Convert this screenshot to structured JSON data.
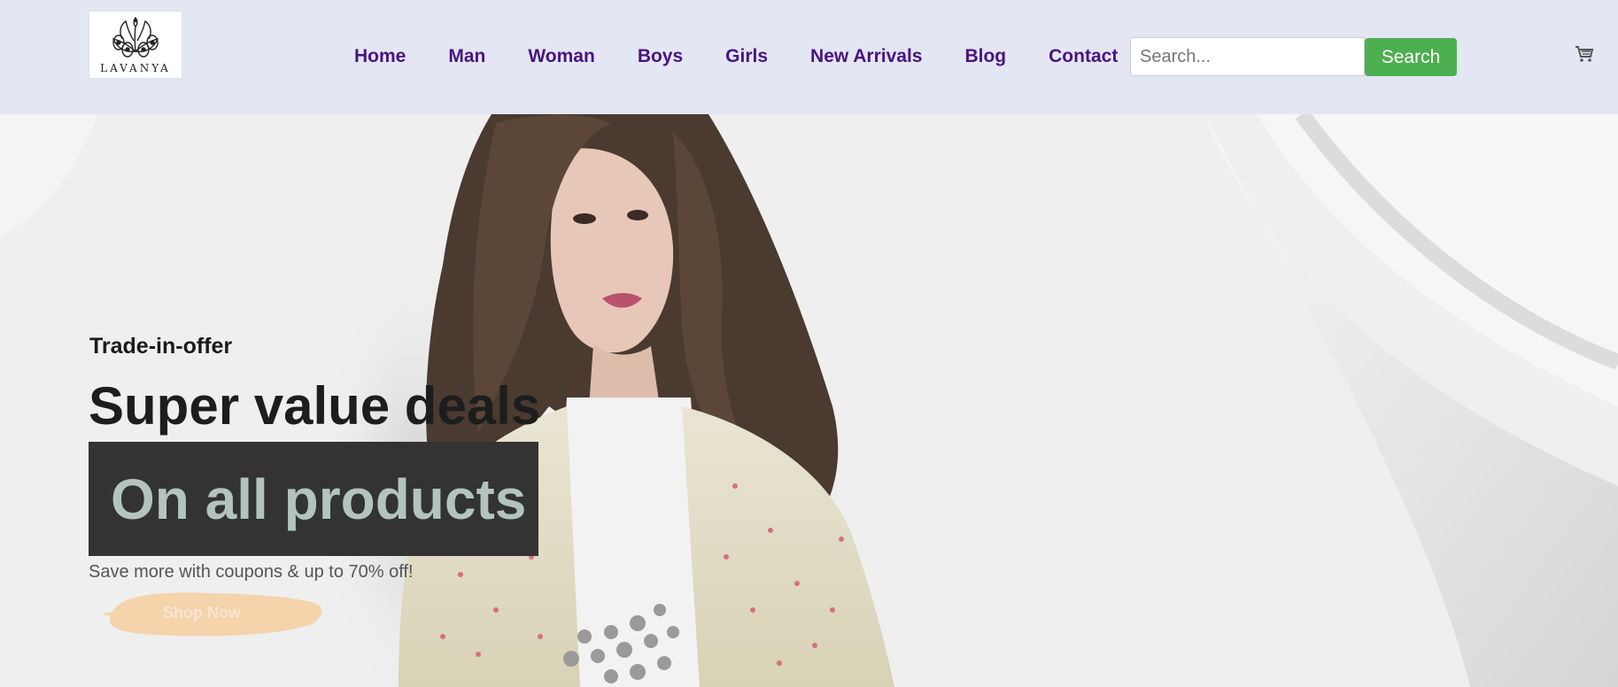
{
  "header": {
    "logo_text": "LAVANYA",
    "nav": [
      "Home",
      "Man",
      "Woman",
      "Boys",
      "Girls",
      "New Arrivals",
      "Blog",
      "Contact"
    ],
    "search_placeholder": "Search...",
    "search_button": "Search",
    "cart_icon": "cart-icon"
  },
  "hero": {
    "eyebrow": "Trade-in-offer",
    "headline": "Super value deals",
    "highlight": "On all products",
    "subtext": "Save more with coupons & up to 70% off!",
    "cta": "Shop Now"
  },
  "colors": {
    "header_bg": "#e3e6f3",
    "nav_text": "#4a1480",
    "search_button": "#4caf50",
    "highlight_box": "#333333",
    "highlight_text": "#b3c4c0",
    "cta_brush": "#f5d3ab"
  }
}
